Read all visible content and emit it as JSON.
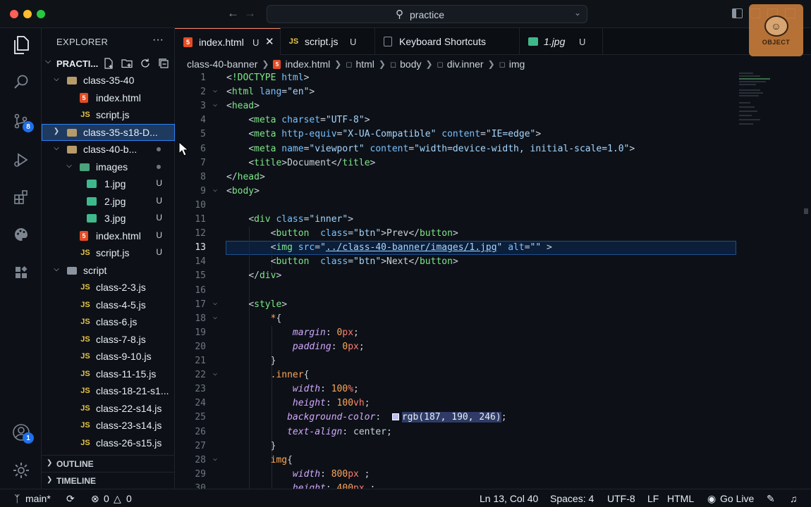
{
  "titlebar": {
    "search_text": "practice"
  },
  "activity": {
    "scm_badge": "8",
    "account_badge": "1"
  },
  "sidebar": {
    "title": "EXPLORER",
    "more": "···",
    "folder": "PRACTI...",
    "tree": [
      {
        "label": "class-35-40",
        "kind": "folder",
        "depth": 1,
        "open": true
      },
      {
        "label": "index.html",
        "kind": "html",
        "depth": 2
      },
      {
        "label": "script.js",
        "kind": "js",
        "depth": 2
      },
      {
        "label": "class-35-s18-D...",
        "kind": "folder",
        "depth": 1,
        "open": false,
        "selected": true
      },
      {
        "label": "class-40-b...",
        "kind": "folder",
        "depth": 1,
        "open": true,
        "dot": true
      },
      {
        "label": "images",
        "kind": "img-folder",
        "depth": 2,
        "open": true,
        "dot": true
      },
      {
        "label": "1.jpg",
        "kind": "img",
        "depth": 3,
        "deco": "U"
      },
      {
        "label": "2.jpg",
        "kind": "img",
        "depth": 3,
        "deco": "U"
      },
      {
        "label": "3.jpg",
        "kind": "img",
        "depth": 3,
        "deco": "U"
      },
      {
        "label": "index.html",
        "kind": "html",
        "depth": 2,
        "deco": "U"
      },
      {
        "label": "script.js",
        "kind": "js",
        "depth": 2,
        "deco": "U"
      },
      {
        "label": "script",
        "kind": "gear-folder",
        "depth": 1,
        "open": true
      },
      {
        "label": "class-2-3.js",
        "kind": "js",
        "depth": 2
      },
      {
        "label": "class-4-5.js",
        "kind": "js",
        "depth": 2
      },
      {
        "label": "class-6.js",
        "kind": "js",
        "depth": 2
      },
      {
        "label": "class-7-8.js",
        "kind": "js",
        "depth": 2
      },
      {
        "label": "class-9-10.js",
        "kind": "js",
        "depth": 2
      },
      {
        "label": "class-11-15.js",
        "kind": "js",
        "depth": 2
      },
      {
        "label": "class-18-21-s1...",
        "kind": "js",
        "depth": 2
      },
      {
        "label": "class-22-s14.js",
        "kind": "js",
        "depth": 2
      },
      {
        "label": "class-23-s14.js",
        "kind": "js",
        "depth": 2
      },
      {
        "label": "class-26-s15.js",
        "kind": "js",
        "depth": 2
      }
    ],
    "outline": "OUTLINE",
    "timeline": "TIMELINE"
  },
  "tabs": [
    {
      "label": "index.html",
      "icon": "html",
      "mod": "U",
      "active": true
    },
    {
      "label": "script.js",
      "icon": "js",
      "mod": "U"
    },
    {
      "label": "Keyboard Shortcuts",
      "icon": "doc"
    },
    {
      "label": "1.jpg",
      "icon": "img",
      "mod": "U",
      "italic": true
    }
  ],
  "breadcrumb": [
    "class-40-banner",
    "index.html",
    "html",
    "body",
    "div.inner",
    "img"
  ],
  "icons": {
    "file_icon": "file-html-icon",
    "js_icon_text": "JS",
    "html_icon_text": "5"
  },
  "code": {
    "current_line": 13,
    "lines": [
      [
        [
          "t-pun",
          "<"
        ],
        [
          "t-tag",
          "!DOCTYPE "
        ],
        [
          "t-attr",
          "html"
        ],
        [
          "t-pun",
          ">"
        ]
      ],
      [
        [
          "t-pun",
          "<"
        ],
        [
          "t-tag",
          "html "
        ],
        [
          "t-attr",
          "lang"
        ],
        [
          "t-pun",
          "="
        ],
        [
          "t-str",
          "\"en\""
        ],
        [
          "t-pun",
          ">"
        ]
      ],
      [
        [
          "t-pun",
          "<"
        ],
        [
          "t-tag",
          "head"
        ],
        [
          "t-pun",
          ">"
        ]
      ],
      [
        [
          "t-txt",
          "    "
        ],
        [
          "t-pun",
          "<"
        ],
        [
          "t-tag",
          "meta "
        ],
        [
          "t-attr",
          "charset"
        ],
        [
          "t-pun",
          "="
        ],
        [
          "t-str",
          "\"UTF-8\""
        ],
        [
          "t-pun",
          ">"
        ]
      ],
      [
        [
          "t-txt",
          "    "
        ],
        [
          "t-pun",
          "<"
        ],
        [
          "t-tag",
          "meta "
        ],
        [
          "t-attr",
          "http-equiv"
        ],
        [
          "t-pun",
          "="
        ],
        [
          "t-str",
          "\"X-UA-Compatible\" "
        ],
        [
          "t-attr",
          "content"
        ],
        [
          "t-pun",
          "="
        ],
        [
          "t-str",
          "\"IE=edge\""
        ],
        [
          "t-pun",
          ">"
        ]
      ],
      [
        [
          "t-txt",
          "    "
        ],
        [
          "t-pun",
          "<"
        ],
        [
          "t-tag",
          "meta "
        ],
        [
          "t-attr",
          "name"
        ],
        [
          "t-pun",
          "="
        ],
        [
          "t-str",
          "\"viewport\" "
        ],
        [
          "t-attr",
          "content"
        ],
        [
          "t-pun",
          "="
        ],
        [
          "t-str",
          "\"width=device-width, initial-scale=1.0\""
        ],
        [
          "t-pun",
          ">"
        ]
      ],
      [
        [
          "t-txt",
          "    "
        ],
        [
          "t-pun",
          "<"
        ],
        [
          "t-tag",
          "title"
        ],
        [
          "t-pun",
          ">"
        ],
        [
          "t-txt",
          "Document"
        ],
        [
          "t-pun",
          "</"
        ],
        [
          "t-tag",
          "title"
        ],
        [
          "t-pun",
          ">"
        ]
      ],
      [
        [
          "t-pun",
          "</"
        ],
        [
          "t-tag",
          "head"
        ],
        [
          "t-pun",
          ">"
        ]
      ],
      [
        [
          "t-pun",
          "<"
        ],
        [
          "t-tag",
          "body"
        ],
        [
          "t-pun",
          ">"
        ]
      ],
      [],
      [
        [
          "t-txt",
          "    "
        ],
        [
          "t-pun",
          "<"
        ],
        [
          "t-tag",
          "div "
        ],
        [
          "t-attr",
          "class"
        ],
        [
          "t-pun",
          "="
        ],
        [
          "t-str",
          "\"inner\""
        ],
        [
          "t-pun",
          ">"
        ]
      ],
      [
        [
          "t-txt",
          "        "
        ],
        [
          "t-pun",
          "<"
        ],
        [
          "t-tag",
          "button  "
        ],
        [
          "t-attr",
          "class"
        ],
        [
          "t-pun",
          "="
        ],
        [
          "t-str",
          "\"btn\""
        ],
        [
          "t-pun",
          ">"
        ],
        [
          "t-txt",
          "Prev"
        ],
        [
          "t-pun",
          "</"
        ],
        [
          "t-tag",
          "button"
        ],
        [
          "t-pun",
          ">"
        ]
      ],
      [
        [
          "t-txt",
          "        "
        ],
        [
          "t-pun",
          "<"
        ],
        [
          "t-tag",
          "img "
        ],
        [
          "t-attr",
          "src"
        ],
        [
          "t-pun",
          "="
        ],
        [
          "t-str",
          "\""
        ],
        [
          "t-link",
          "../class-40-banner/images/1.jpg"
        ],
        [
          "t-str",
          "\" "
        ],
        [
          "t-attr",
          "alt"
        ],
        [
          "t-pun",
          "="
        ],
        [
          "t-str",
          "\"\" "
        ],
        [
          "t-pun",
          ">"
        ]
      ],
      [
        [
          "t-txt",
          "        "
        ],
        [
          "t-pun",
          "<"
        ],
        [
          "t-tag",
          "button  "
        ],
        [
          "t-attr",
          "class"
        ],
        [
          "t-pun",
          "="
        ],
        [
          "t-str",
          "\"btn\""
        ],
        [
          "t-pun",
          ">"
        ],
        [
          "t-txt",
          "Next"
        ],
        [
          "t-pun",
          "</"
        ],
        [
          "t-tag",
          "button"
        ],
        [
          "t-pun",
          ">"
        ]
      ],
      [
        [
          "t-txt",
          "    "
        ],
        [
          "t-pun",
          "</"
        ],
        [
          "t-tag",
          "div"
        ],
        [
          "t-pun",
          ">"
        ]
      ],
      [],
      [
        [
          "t-txt",
          "    "
        ],
        [
          "t-pun",
          "<"
        ],
        [
          "t-tag",
          "style"
        ],
        [
          "t-pun",
          ">"
        ]
      ],
      [
        [
          "t-txt",
          "        "
        ],
        [
          "t-sel",
          "*"
        ],
        [
          "t-pun",
          "{"
        ]
      ],
      [
        [
          "t-txt",
          "            "
        ],
        [
          "t-prop",
          "margin"
        ],
        [
          "t-pun",
          ": "
        ],
        [
          "t-num",
          "0"
        ],
        [
          "t-unit",
          "px"
        ],
        [
          "t-pun",
          ";"
        ]
      ],
      [
        [
          "t-txt",
          "            "
        ],
        [
          "t-prop",
          "padding"
        ],
        [
          "t-pun",
          ": "
        ],
        [
          "t-num",
          "0"
        ],
        [
          "t-unit",
          "px"
        ],
        [
          "t-pun",
          ";"
        ]
      ],
      [
        [
          "t-txt",
          "        "
        ],
        [
          "t-pun",
          "}"
        ]
      ],
      [
        [
          "t-txt",
          "        "
        ],
        [
          "t-sel",
          ".inner"
        ],
        [
          "t-pun",
          "{"
        ]
      ],
      [
        [
          "t-txt",
          "            "
        ],
        [
          "t-prop",
          "width"
        ],
        [
          "t-pun",
          ": "
        ],
        [
          "t-num",
          "100"
        ],
        [
          "t-unit",
          "%"
        ],
        [
          "t-pun",
          ";"
        ]
      ],
      [
        [
          "t-txt",
          "            "
        ],
        [
          "t-prop",
          "height"
        ],
        [
          "t-pun",
          ": "
        ],
        [
          "t-num",
          "100"
        ],
        [
          "t-unit",
          "vh"
        ],
        [
          "t-pun",
          ";"
        ]
      ],
      [
        [
          "t-txt",
          "           "
        ],
        [
          "t-prop",
          "background-color"
        ],
        [
          "t-pun",
          ":  "
        ],
        [
          "swatch",
          ""
        ],
        [
          "t-color",
          "rgb(187, 190, 246)"
        ],
        [
          "t-pun",
          ";"
        ]
      ],
      [
        [
          "t-txt",
          "           "
        ],
        [
          "t-prop",
          "text-align"
        ],
        [
          "t-pun",
          ": "
        ],
        [
          "t-txt",
          "center"
        ],
        [
          "t-pun",
          ";"
        ]
      ],
      [
        [
          "t-txt",
          "        "
        ],
        [
          "t-pun",
          "}"
        ]
      ],
      [
        [
          "t-txt",
          "        "
        ],
        [
          "t-sel",
          "img"
        ],
        [
          "t-pun",
          "{"
        ]
      ],
      [
        [
          "t-txt",
          "            "
        ],
        [
          "t-prop",
          "width"
        ],
        [
          "t-pun",
          ": "
        ],
        [
          "t-num",
          "800"
        ],
        [
          "t-unit",
          "px"
        ],
        [
          "t-pun",
          " ;"
        ]
      ],
      [
        [
          "t-txt",
          "            "
        ],
        [
          "t-prop",
          "height"
        ],
        [
          "t-pun",
          ": "
        ],
        [
          "t-num",
          "400"
        ],
        [
          "t-unit",
          "px"
        ],
        [
          "t-pun",
          " ;"
        ]
      ]
    ]
  },
  "status": {
    "branch": "main*",
    "errors": "0",
    "warnings": "0",
    "position": "Ln 13, Col 40",
    "spaces": "Spaces: 4",
    "encoding": "UTF-8",
    "eol": "LF",
    "language": "HTML",
    "golive": "Go Live"
  },
  "colors": {
    "accent": "#1f6feb",
    "swatch": "#bbbef6"
  }
}
